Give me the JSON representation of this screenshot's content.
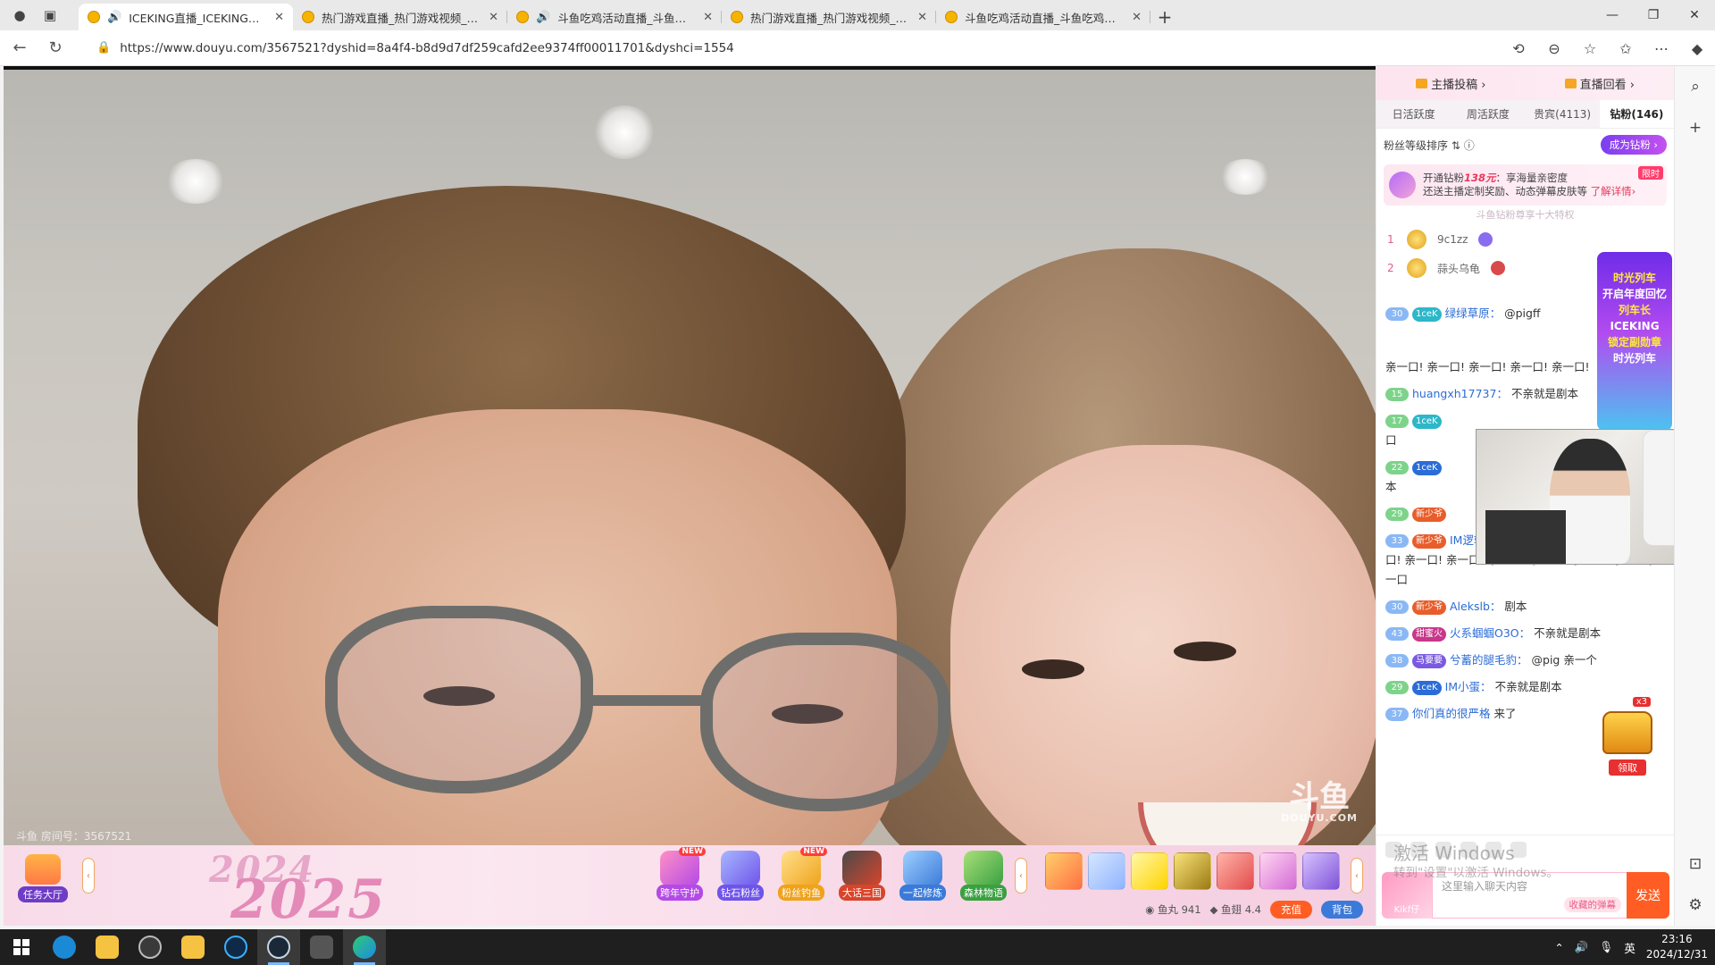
{
  "browser": {
    "tabs": [
      {
        "title": "ICEKING直播_ICEKING直播",
        "active": true,
        "audio": true
      },
      {
        "title": "热门游戏直播_热门游戏视频_热门",
        "active": false,
        "audio": false
      },
      {
        "title": "斗鱼吃鸡活动直播_斗鱼吃鸡",
        "active": false,
        "audio": true
      },
      {
        "title": "热门游戏直播_热门游戏视频_热门",
        "active": false,
        "audio": false
      },
      {
        "title": "斗鱼吃鸡活动直播_斗鱼吃鸡活动",
        "active": false,
        "audio": false
      }
    ],
    "url": "https://www.douyu.com/3567521?dyshid=8a4f4-b8d9d7df259cafd2ee9374ff00011701&dyshci=1554"
  },
  "video": {
    "watermark": "斗鱼",
    "watermark_sub": "DOUYU.COM",
    "room_label": "斗鱼 房间号：3567521"
  },
  "giftbar": {
    "task_hall": "任务大厅",
    "year_a": "2024",
    "year_b": "2025",
    "activities": [
      {
        "label": "跨年守护",
        "new": "NEW",
        "color": "#b44ae6"
      },
      {
        "label": "钻石粉丝",
        "new": "",
        "color": "#6f54ea"
      },
      {
        "label": "粉丝钓鱼",
        "new": "NEW",
        "color": "#f0a21b"
      },
      {
        "label": "大话三国",
        "new": "",
        "color": "#d8452b"
      },
      {
        "label": "一起修炼",
        "new": "",
        "color": "#3b7ad9"
      },
      {
        "label": "森林物语",
        "new": "",
        "color": "#3aa040"
      }
    ],
    "fish_ball_label": "鱼丸",
    "fish_ball_value": "941",
    "fish_fin_label": "鱼翅",
    "fish_fin_value": "4.4",
    "recharge": "充值",
    "backpack": "背包"
  },
  "panel": {
    "top_links": [
      "主播投稿 ›",
      "直播回看 ›"
    ],
    "tabs": [
      "日活跃度",
      "周活跃度",
      "贵宾(4113)",
      "钻粉(146)"
    ],
    "fan_rank_label": "粉丝等级排序",
    "be_fan": "成为钻粉 ›",
    "promo_prefix": "开通钻粉",
    "promo_price": "138元",
    "promo_line1_rest": "：享海量亲密度",
    "promo_line2": "还送主播定制奖励、动态弹幕皮肤等",
    "promo_more": "了解详情›",
    "promo_tag": "限时",
    "hint": "斗鱼钻粉尊享十大特权",
    "ranks": [
      {
        "no": "1",
        "name": "9c1zz"
      },
      {
        "no": "2",
        "name": "蒜头乌龟"
      }
    ],
    "chat": [
      {
        "lvl": "30",
        "badge": "1ceK",
        "user": "绿绿草原：",
        "text": "@pigff"
      },
      {
        "lvl": "",
        "badge": "",
        "user": "",
        "text": "亲一口! 亲一口! 亲一口! 亲一口! 亲一口!"
      },
      {
        "lvl": "15",
        "badge": "",
        "user": "huangxh17737：",
        "text": "不亲就是剧本"
      },
      {
        "lvl": "17",
        "badge": "1ceK",
        "user": "",
        "text": "口"
      },
      {
        "lvl": "22",
        "badge": "1ceK",
        "user": "",
        "text": "本"
      },
      {
        "lvl": "29",
        "badge": "新少爷",
        "user": "",
        "text": ""
      },
      {
        "lvl": "33",
        "badge": "新少爷",
        "user": "IM逻辑君：",
        "text": "亲一口! 亲一口! 亲一口! 亲一口! 亲一口! 亲一口! 亲一口! 亲一口! 亲一口! 亲一口亲一口"
      },
      {
        "lvl": "30",
        "badge": "新少爷",
        "user": "Alekslb：",
        "text": "剧本"
      },
      {
        "lvl": "43",
        "badge": "甜蜜火",
        "user": "火系蝈蝈O3O：",
        "text": "不亲就是剧本"
      },
      {
        "lvl": "38",
        "badge": "马要要",
        "user": "兮蓄的腿毛豹：",
        "text": "@pig 亲一个"
      },
      {
        "lvl": "29",
        "badge": "1ceK",
        "user": "IM小蛋：",
        "text": "不亲就是剧本"
      },
      {
        "lvl": "37",
        "badge": "",
        "user": "你们真的很严格",
        "text": "来了"
      }
    ],
    "input_placeholder": "这里输入聊天内容",
    "input_sticker": "收藏的弹幕",
    "send": "发送",
    "avatar_tag": "Kikf仔"
  },
  "banner": {
    "line1": "时光列车",
    "line2": "开启年度回忆",
    "line3": "列车长",
    "line4": "ICEKING",
    "line5": "锁定副勋章",
    "line6": "时光列车"
  },
  "chest": {
    "count": "x3",
    "claim": "领取"
  },
  "windows_activation": {
    "title": "激活 Windows",
    "sub": "转到\"设置\"以激活 Windows。"
  },
  "taskbar": {
    "time": "23:16",
    "date": "2024/12/31",
    "ime": "英"
  },
  "colors": {
    "douyu_orange": "#ff5d23",
    "link_blue": "#2b6cd6",
    "pink_bg": "#fbe7f0"
  }
}
